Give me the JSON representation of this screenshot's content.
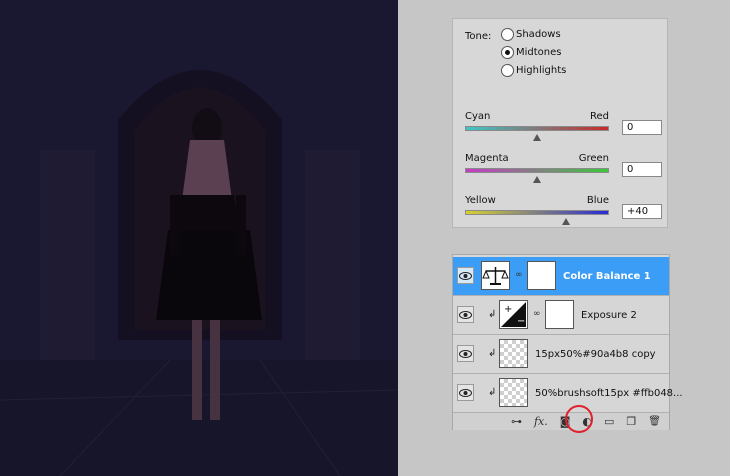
{
  "color_balance": {
    "tone_label": "Tone:",
    "tones": [
      {
        "label": "Shadows",
        "checked": false
      },
      {
        "label": "Midtones",
        "checked": true
      },
      {
        "label": "Highlights",
        "checked": false
      }
    ],
    "sliders": [
      {
        "left": "Cyan",
        "right": "Red",
        "value": "0",
        "level": 0.5,
        "gradient": [
          "#3ec7c7",
          "#c72a2a"
        ]
      },
      {
        "left": "Magenta",
        "right": "Green",
        "value": "0",
        "level": 0.5,
        "gradient": [
          "#c83bc8",
          "#3bc83b"
        ]
      },
      {
        "left": "Yellow",
        "right": "Blue",
        "value": "+40",
        "level": 0.7,
        "gradient": [
          "#d6d22e",
          "#2a2ad6"
        ]
      }
    ]
  },
  "layers": [
    {
      "name": "Color Balance 1",
      "type": "adjustment",
      "icon": "balance-scale-icon",
      "selected": true,
      "clipped": false
    },
    {
      "name": "Exposure 2",
      "type": "adjustment",
      "icon": "exposure-icon",
      "selected": false,
      "clipped": true
    },
    {
      "name": "15px50%#90a4b8 copy",
      "type": "pixel",
      "selected": false,
      "clipped": true
    },
    {
      "name": "50%brushsoft15px #ffb048...",
      "type": "pixel",
      "selected": false,
      "clipped": true
    }
  ],
  "toolbar_icons": [
    "link-layers-icon",
    "fx-icon",
    "layer-mask-icon",
    "adjustment-layer-icon",
    "group-folder-icon",
    "new-layer-icon",
    "trash-icon"
  ],
  "toolbar_glyphs": {
    "link": "⊶",
    "fx": "fx.",
    "mask": "◙",
    "adjust": "◐",
    "group": "▭",
    "new": "❐",
    "trash": "🗑"
  },
  "colors": {
    "selected_layer": "#3b9df5",
    "highlight_circle": "#e0202a"
  }
}
